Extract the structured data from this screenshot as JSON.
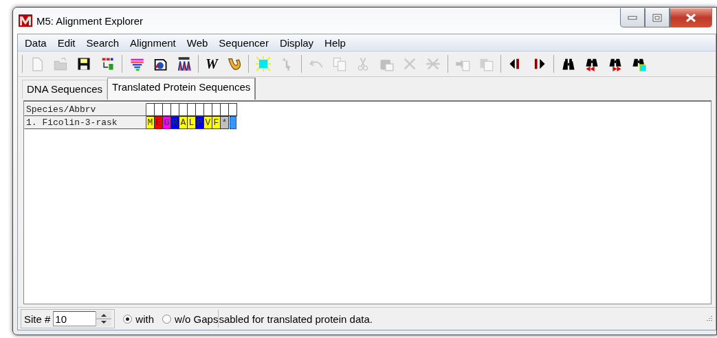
{
  "window": {
    "title": "M5: Alignment Explorer"
  },
  "menu": [
    "Data",
    "Edit",
    "Search",
    "Alignment",
    "Web",
    "Sequencer",
    "Display",
    "Help"
  ],
  "toolbar": [
    [
      {
        "kind": "new",
        "disabled": true
      },
      {
        "kind": "open",
        "disabled": true
      },
      {
        "kind": "save",
        "disabled": false
      },
      {
        "kind": "translate",
        "disabled": false
      }
    ],
    [
      {
        "kind": "align",
        "disabled": false
      },
      {
        "kind": "web",
        "disabled": false
      },
      {
        "kind": "sequencer",
        "disabled": false
      }
    ],
    [
      {
        "kind": "clustal",
        "label": "W",
        "disabled": false
      },
      {
        "kind": "muscle",
        "disabled": false
      }
    ],
    [
      {
        "kind": "mark",
        "disabled": false
      },
      {
        "kind": "insert-gap",
        "disabled": true
      }
    ],
    [
      {
        "kind": "undo",
        "disabled": true
      },
      {
        "kind": "copy",
        "disabled": true
      },
      {
        "kind": "cut",
        "disabled": true
      },
      {
        "kind": "paste",
        "disabled": true
      },
      {
        "kind": "delete",
        "disabled": true
      },
      {
        "kind": "delete-gaps",
        "disabled": true
      }
    ],
    [
      {
        "kind": "add-sequence",
        "disabled": true
      },
      {
        "kind": "add-file",
        "disabled": true
      }
    ],
    [
      {
        "kind": "prev",
        "disabled": false
      },
      {
        "kind": "next",
        "disabled": false
      }
    ],
    [
      {
        "kind": "find",
        "disabled": false
      },
      {
        "kind": "find-prev",
        "disabled": false
      },
      {
        "kind": "find-next",
        "disabled": false
      },
      {
        "kind": "find-marked",
        "disabled": false
      }
    ]
  ],
  "tabs": [
    {
      "label": "DNA Sequences",
      "selected": false
    },
    {
      "label": "Translated Protein Sequences",
      "selected": true
    }
  ],
  "grid": {
    "header": "Species/Abbrv",
    "rows": [
      {
        "name": "1. Ficolin-3-rask",
        "cursor": true,
        "residues": [
          {
            "text": "M",
            "color": "#ffff00"
          },
          {
            "text": "E",
            "color": "#ff0000"
          },
          {
            "text": "G",
            "color": "#ff00ff"
          },
          {
            "text": "R",
            "color": "#0000ff"
          },
          {
            "text": "A",
            "color": "#ffff00"
          },
          {
            "text": "L",
            "color": "#ffff00"
          },
          {
            "text": "P",
            "color": "#0000ff"
          },
          {
            "text": "V",
            "color": "#ffff00"
          },
          {
            "text": "F",
            "color": "#ffff00"
          },
          {
            "text": "*",
            "color": "#c0c0c0"
          }
        ]
      }
    ]
  },
  "status": {
    "site_label": "Site #",
    "site_value": "10",
    "gap_options": [
      {
        "label": "with",
        "selected": true
      },
      {
        "label": "w/o Gaps",
        "selected": false
      }
    ],
    "message": "sabled for translated protein data."
  }
}
